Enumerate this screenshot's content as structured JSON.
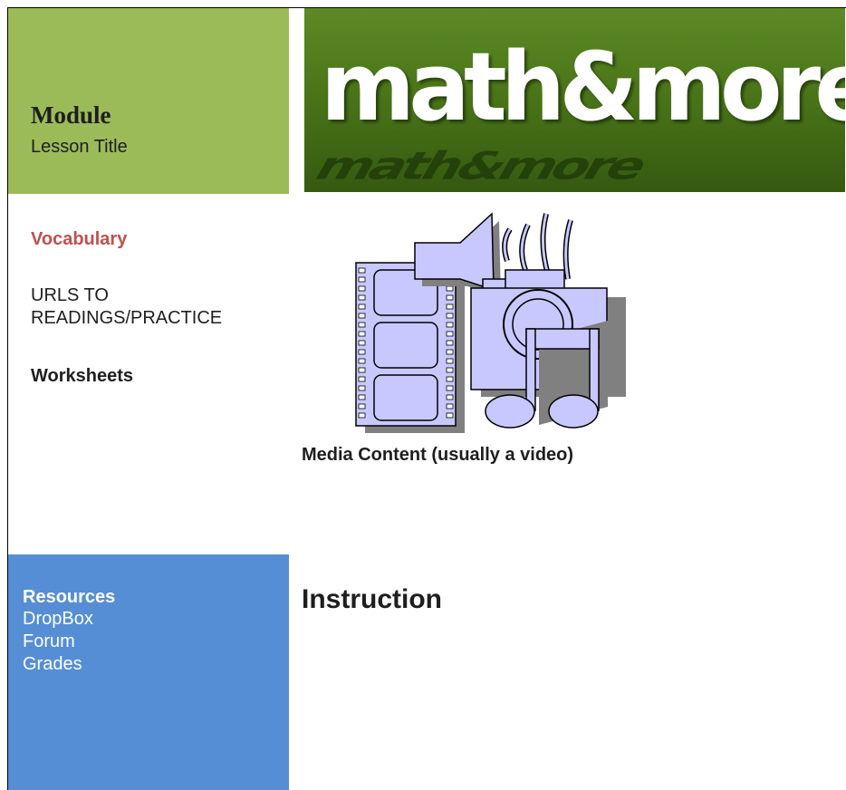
{
  "header": {
    "module": "Module",
    "lesson_title": "Lesson Title",
    "banner_logo": "math&more"
  },
  "nav": {
    "vocabulary": "Vocabulary",
    "urls_line1": "URLS TO",
    "urls_line2": "READINGS/PRACTICE",
    "worksheets": "Worksheets"
  },
  "media": {
    "icon": "multimedia-clipart-icon",
    "caption": "Media Content (usually a video)"
  },
  "resources": {
    "title": "Resources",
    "items": [
      "DropBox",
      "Forum",
      "Grades"
    ]
  },
  "main": {
    "instruction": "Instruction"
  },
  "colors": {
    "green_panel": "#9bbb59",
    "blue_panel": "#558ed5",
    "vocab_red": "#c0504d",
    "banner_green": "#4a7619"
  }
}
